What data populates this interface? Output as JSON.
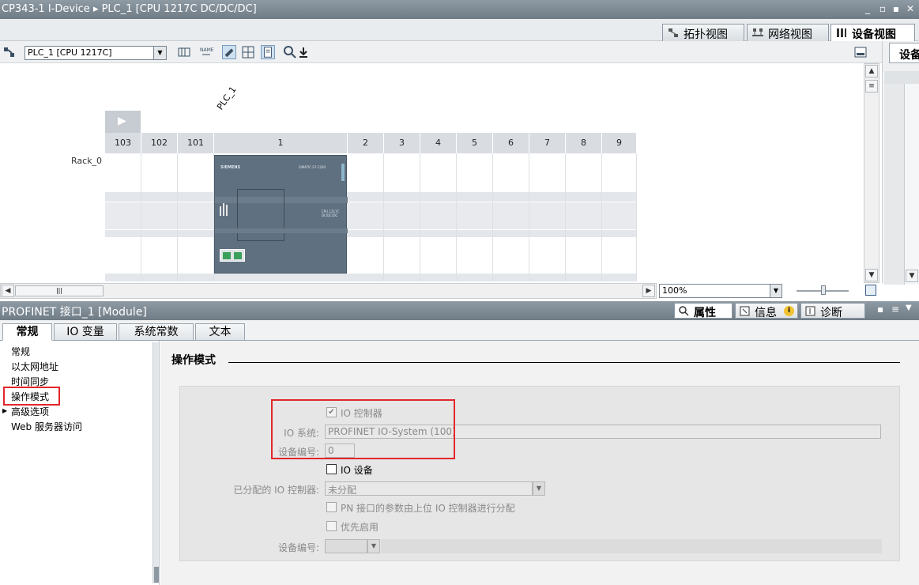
{
  "window": {
    "title": "CP343-1 I-Device ▸ PLC_1 [CPU 1217C DC/DC/DC]"
  },
  "view_tabs": [
    {
      "label": "拓扑视图"
    },
    {
      "label": "网络视图"
    },
    {
      "label": "设备视图"
    }
  ],
  "right_panel_tab": "设备",
  "toolbar": {
    "device_select": "PLC_1 [CPU 1217C]"
  },
  "rack": {
    "device_name": "PLC_1",
    "rack_label": "Rack_0",
    "slots": [
      "103",
      "102",
      "101",
      "1",
      "2",
      "3",
      "4",
      "5",
      "6",
      "7",
      "8",
      "9"
    ],
    "cpu_brand": "SIEMENS",
    "cpu_model_text": "SIMATIC S7-1200",
    "cpu_type_text": "CPU 1217C DC/DC/DC"
  },
  "zoom": {
    "value": "100%"
  },
  "properties_panel": {
    "header": "PROFINET 接口_1 [Module]",
    "tabs": [
      {
        "label": "属性"
      },
      {
        "label": "信息"
      },
      {
        "label": "诊断"
      }
    ]
  },
  "sub_tabs": [
    "常规",
    "IO 变量",
    "系统常数",
    "文本"
  ],
  "nav": {
    "items": [
      "常规",
      "以太网地址",
      "时间同步",
      "操作模式",
      "高级选项",
      "Web 服务器访问"
    ]
  },
  "section": {
    "title": "操作模式",
    "io_controller_label": "IO 控制器",
    "io_system_label": "IO 系统:",
    "io_system_value": "PROFINET IO-System (100)",
    "device_number_label": "设备编号:",
    "device_number_value": "0",
    "io_device_label": "IO 设备",
    "assigned_controller_label": "已分配的 IO 控制器:",
    "assigned_controller_value": "未分配",
    "pn_param_label": "PN 接口的参数由上位 IO 控制器进行分配",
    "priority_startup_label": "优先启用",
    "device_number2_label": "设备编号:"
  }
}
